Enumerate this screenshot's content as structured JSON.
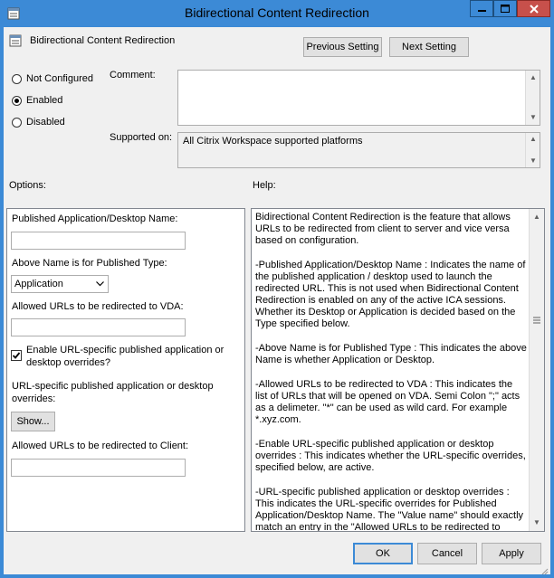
{
  "window": {
    "title": "Bidirectional Content Redirection"
  },
  "header": {
    "setting_name": "Bidirectional Content Redirection",
    "previous_label": "Previous Setting",
    "next_label": "Next Setting"
  },
  "state": {
    "options": [
      {
        "label": "Not Configured",
        "selected": false
      },
      {
        "label": "Enabled",
        "selected": true
      },
      {
        "label": "Disabled",
        "selected": false
      }
    ]
  },
  "comment": {
    "label": "Comment:",
    "value": ""
  },
  "supported": {
    "label": "Supported on:",
    "value": "All Citrix Workspace supported platforms"
  },
  "section_labels": {
    "options": "Options:",
    "help": "Help:"
  },
  "options_panel": {
    "app_name_label": "Published Application/Desktop Name:",
    "app_name_value": "",
    "type_label": "Above Name is for Published Type:",
    "type_value": "Application",
    "vda_urls_label": "Allowed URLs to be redirected to VDA:",
    "vda_urls_value": "",
    "enable_override_label_1": "Enable URL-specific published application or",
    "enable_override_label_2": "desktop overrides?",
    "enable_override_checked": true,
    "overrides_label_1": "URL-specific published application or desktop",
    "overrides_label_2": "overrides:",
    "show_button": "Show...",
    "client_urls_label": "Allowed URLs to be redirected to Client:",
    "client_urls_value": ""
  },
  "help_panel": {
    "paragraphs": [
      "Bidirectional Content Redirection is the feature that allows URLs to be redirected from client to server and vice versa based on configuration.",
      "-Published Application/Desktop Name : Indicates the name of the published application / desktop used to launch the redirected URL. This is not used when Bidirectional Content Redirection is enabled on any of the active ICA sessions. Whether its Desktop or Application is decided based on the Type specified below.",
      "-Above Name is for Published Type : This indicates the above Name is whether Application or Desktop.",
      "-Allowed URLs to be redirected to VDA : This indicates the list of URLs that will be opened on VDA. Semi Colon \";\" acts as a delimeter. \"*\" can be used as wild card. For example *.xyz.com.",
      "-Enable URL-specific published application or desktop overrides : This indicates whether the URL-specific overrides, specified below, are active.",
      "-URL-specific published application or desktop overrides : This indicates the URL-specific overrides for Published Application/Desktop Name.  The \"Value name\" should exactly match an entry in the \"Allowed URLs to be redirected to VDA\""
    ]
  },
  "footer": {
    "ok": "OK",
    "cancel": "Cancel",
    "apply": "Apply"
  },
  "icons": {
    "app": "policy-icon",
    "min": "minimize-icon",
    "max": "maximize-icon",
    "close": "close-icon"
  },
  "colors": {
    "titlebar": "#3c8ad6",
    "close": "#c7504b"
  }
}
